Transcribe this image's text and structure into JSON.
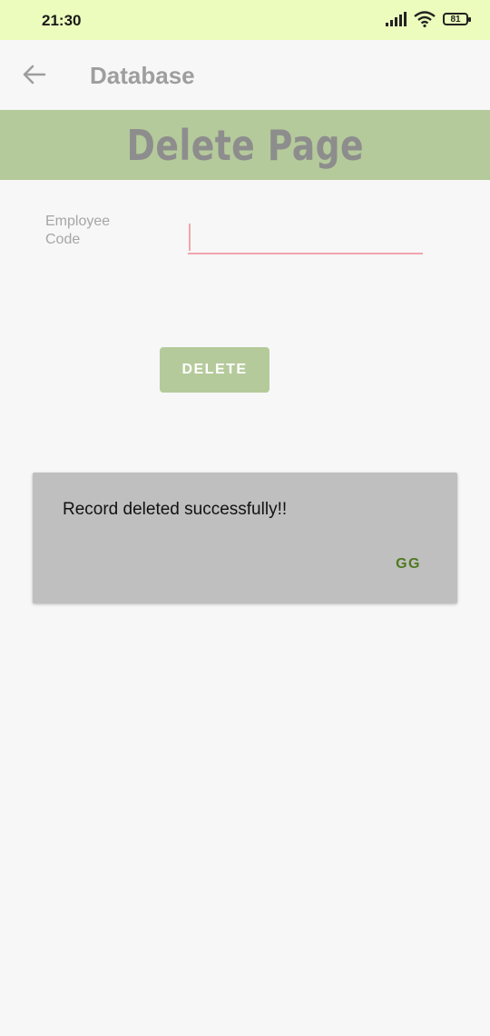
{
  "status_bar": {
    "time": "21:30",
    "battery": "81",
    "icons": [
      "signal-icon",
      "wifi-icon",
      "battery-icon"
    ]
  },
  "toolbar": {
    "back_icon": "arrow-left-icon",
    "title": "Database"
  },
  "banner": {
    "title": "Delete Page"
  },
  "form": {
    "employee_code_label": "Employee Code",
    "employee_code_value": "",
    "delete_button_label": "DELETE"
  },
  "dialog": {
    "message": "Record deleted successfully!!",
    "button_label": "GG"
  },
  "colors": {
    "status_bar": "#ebfcbd",
    "accent": "#b5ca9b",
    "input_underline": "#f2a5ad",
    "dialog_bg": "#bfbfbf",
    "dialog_button": "#4f7a21"
  }
}
